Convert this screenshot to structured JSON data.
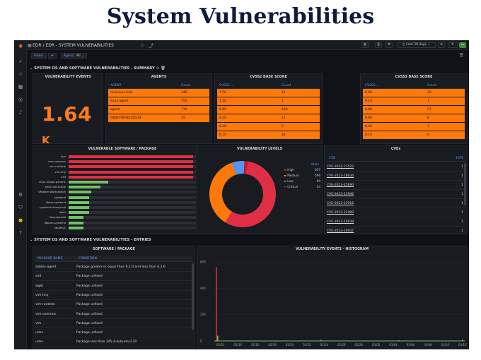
{
  "heading": "System Vulnerabilities",
  "topbar": {
    "breadcrumb": "EDR / EDR - SYSTEM VULNERABILITIES",
    "time_range": "Last 30 days"
  },
  "filters": {
    "filters_label": "Filters",
    "add": "+",
    "agent_label": "Agent",
    "agent_value": "All"
  },
  "sections": {
    "summary": "SYSTEM OS AND SOFTWARE VULNERABILITIES - SUMMARY",
    "entries": "SYSTEM OS AND SOFTWARE VULNERABILITIES - ENTRIES"
  },
  "vuln_events": {
    "title": "VULNERABILITY EVENTS",
    "value": "1.64",
    "unit": "K"
  },
  "agents": {
    "title": "AGENTS",
    "headers": [
      "AGENT",
      "Count"
    ],
    "rows": [
      [
        "massive-node",
        "146"
      ],
      [
        "linux-agent",
        "755"
      ],
      [
        "agent",
        "715"
      ],
      [
        "DESKTOP-N22D519",
        "25"
      ]
    ]
  },
  "cvss2": {
    "title": "CVSS2 BASE SCORE",
    "headers": [
      "CVSS2",
      "Count"
    ],
    "rows": [
      [
        "7.50",
        "14"
      ],
      [
        "7.20",
        "1"
      ],
      [
        "6.80",
        "456"
      ],
      [
        "6.50",
        "11"
      ],
      [
        "6.40",
        "2"
      ],
      [
        "6.10",
        "24"
      ]
    ]
  },
  "cvss3": {
    "title": "CVSS3 BASE SCORE",
    "headers": [
      "CVSS3",
      "Count"
    ],
    "rows": [
      [
        "9.80",
        "35"
      ],
      [
        "9.10",
        "1"
      ],
      [
        "8.80",
        "27"
      ],
      [
        "8.60",
        "8"
      ],
      [
        "8.40",
        "1"
      ],
      [
        "8.10",
        "6"
      ]
    ]
  },
  "software": {
    "title": "VULNERABLE SOFTWARE / PACKAGE",
    "items": [
      {
        "name": "vim",
        "value": 156,
        "color": "#e02f44"
      },
      {
        "name": "vim-common",
        "value": 156,
        "color": "#e02f44"
      },
      {
        "name": "vim-runtime",
        "value": 156,
        "color": "#e02f44"
      },
      {
        "name": "vim-tiny",
        "value": 156,
        "color": "#e02f44"
      },
      {
        "name": "xxd",
        "value": 156,
        "color": "#e02f44"
      },
      {
        "name": "linux-image-generic",
        "value": 50,
        "color": "#73bf69"
      },
      {
        "name": "intel-microcode",
        "value": 40,
        "color": "#73bf69"
      },
      {
        "name": "VMware Workstation",
        "value": 28,
        "color": "#73bf69"
      },
      {
        "name": "systemd",
        "value": 26,
        "color": "#73bf69"
      },
      {
        "name": "libnss-systemd",
        "value": 26,
        "color": "#73bf69"
      },
      {
        "name": "systemd-timesyncd",
        "value": 26,
        "color": "#73bf69"
      },
      {
        "name": "udev",
        "value": 26,
        "color": "#73bf69"
      },
      {
        "name": "libsystemd0",
        "value": 19,
        "color": "#73bf69"
      },
      {
        "name": "libpam-systemd",
        "value": 19,
        "color": "#73bf69"
      },
      {
        "name": "libudev1",
        "value": 19,
        "color": "#73bf69"
      }
    ],
    "max": 160
  },
  "levels": {
    "title": "VULNERABILITY LEVELS",
    "value_header": "Value",
    "items": [
      {
        "name": "High",
        "value": 927,
        "color": "#e02f44"
      },
      {
        "name": "Medium",
        "value": 596,
        "color": "#ff780a"
      },
      {
        "name": "Low",
        "value": 99,
        "color": "#5794f2"
      },
      {
        "name": "Critical",
        "value": 24,
        "color": "#c4162a"
      }
    ]
  },
  "cves": {
    "title": "CVEs",
    "headers": [
      "CVE",
      "HITS"
    ],
    "rows": [
      [
        "CVE-2022-37522",
        "1"
      ],
      [
        "CVE-2023-28834",
        "1"
      ],
      [
        "CVE-2023-25690",
        "1"
      ],
      [
        "CVE-2023-22946",
        "1"
      ],
      [
        "CVE-2023-23916",
        "1"
      ],
      [
        "CVE-2023-22490",
        "1"
      ],
      [
        "CVE-2023-20938",
        "1"
      ],
      [
        "CVE-2023-20937",
        "1"
      ]
    ]
  },
  "entries": {
    "title": "SOFTWARE / PACKAGE",
    "headers": [
      "PACKAGE NAME",
      "CONDITION"
    ],
    "rows": [
      [
        "zabbix-agent",
        "Package greater or equal than 6.2.0 and less than 6.2.6"
      ],
      [
        "xxd",
        "Package unfixed"
      ],
      [
        "wget",
        "Package unfixed"
      ],
      [
        "vim-tiny",
        "Package unfixed"
      ],
      [
        "vim-runtime",
        "Package unfixed"
      ],
      [
        "vim-common",
        "Package unfixed"
      ],
      [
        "vim",
        "Package unfixed"
      ],
      [
        "udev",
        "Package unfixed"
      ],
      [
        "udev",
        "Package less than 245.4-4ubuntu3.20"
      ]
    ]
  },
  "histogram": {
    "title": "VULNERABILITY EVENTS - HISTOGRAM",
    "y_ticks": [
      "600",
      "400",
      "200",
      "0"
    ],
    "x_ticks": [
      "02/12",
      "02/14",
      "02/16",
      "02/18",
      "02/20",
      "02/22",
      "02/24",
      "02/26",
      "02/28",
      "03/02",
      "03/04",
      "03/06",
      "03/08",
      "03/10",
      "03/12"
    ]
  },
  "chart_data": [
    {
      "type": "bar",
      "categories": [
        "vim",
        "vim-common",
        "vim-runtime",
        "vim-tiny",
        "xxd",
        "linux-image-generic",
        "intel-microcode",
        "VMware Workstation",
        "systemd",
        "libnss-systemd",
        "systemd-timesyncd",
        "udev",
        "libsystemd0",
        "libpam-systemd",
        "libudev1"
      ],
      "values": [
        156,
        156,
        156,
        156,
        156,
        50,
        40,
        28,
        26,
        26,
        26,
        26,
        19,
        19,
        19
      ],
      "title": "VULNERABLE SOFTWARE / PACKAGE"
    },
    {
      "type": "pie",
      "categories": [
        "High",
        "Medium",
        "Low",
        "Critical"
      ],
      "values": [
        927,
        596,
        99,
        24
      ],
      "title": "VULNERABILITY LEVELS"
    },
    {
      "type": "bar",
      "title": "VULNERABILITY EVENTS - HISTOGRAM",
      "categories": [
        "02/12",
        "02/14",
        "02/16",
        "02/18",
        "02/20",
        "02/22",
        "02/24",
        "02/26",
        "02/28",
        "03/02",
        "03/04",
        "03/06",
        "03/08",
        "03/10",
        "03/12"
      ],
      "values": [
        560,
        0,
        0,
        0,
        0,
        0,
        0,
        0,
        0,
        0,
        0,
        0,
        0,
        0,
        0
      ],
      "ylim": [
        0,
        600
      ]
    }
  ]
}
